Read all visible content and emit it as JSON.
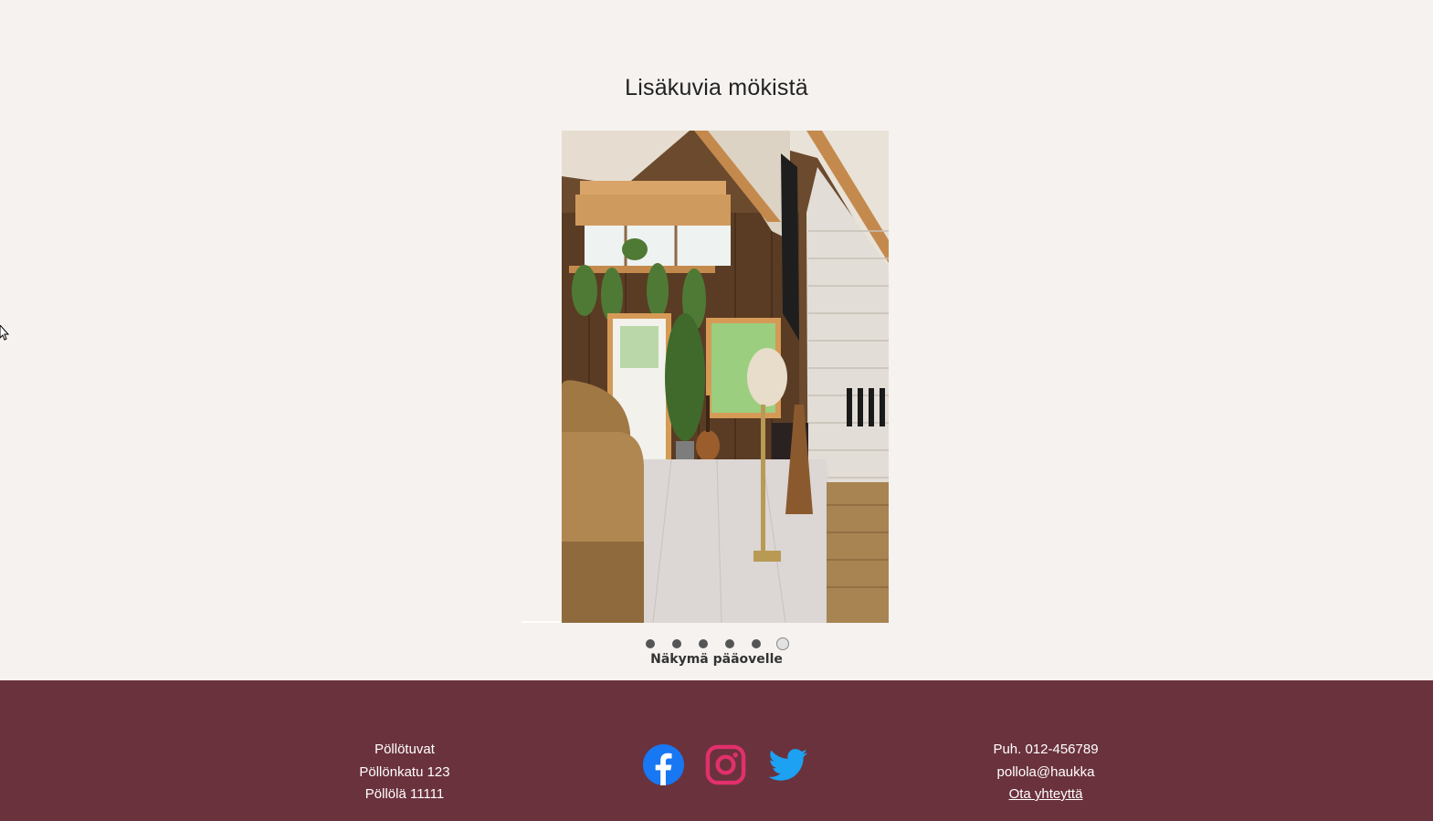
{
  "gallery": {
    "heading": "Lisäkuvia mökistä",
    "caption": "Näkymä pääovelle",
    "slide_count": 6,
    "active_slide": 6
  },
  "footer": {
    "company": "Pöllötuvat",
    "street": "Pöllönkatu 123",
    "city": "Pöllölä 11111",
    "phone": "Puh. 012-456789",
    "email": "pollola@haukka",
    "contact_link": "Ota yhteyttä",
    "social": [
      {
        "icon": "facebook-icon",
        "color": "#1877f2"
      },
      {
        "icon": "instagram-icon",
        "color": "#e1306c"
      },
      {
        "icon": "twitter-icon",
        "color": "#1da1f2"
      }
    ]
  },
  "colors": {
    "background": "#f5f2ef",
    "footer": "#6a323d"
  }
}
